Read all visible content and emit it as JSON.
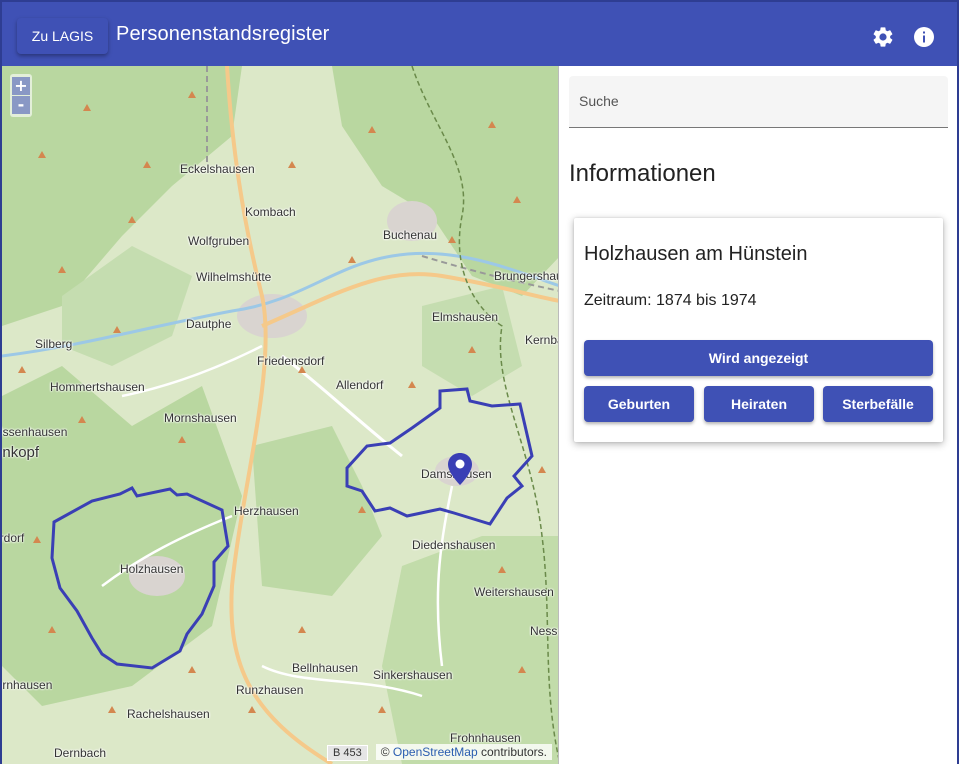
{
  "header": {
    "lagis_button": "Zu LAGIS",
    "title": "Personenstandsregister",
    "settings_icon": "gear-icon",
    "info_icon": "info-icon"
  },
  "map": {
    "zoom_in": "+",
    "zoom_out": "-",
    "places": [
      "Eckelshausen",
      "Kombach",
      "Buchenau",
      "Wolfgruben",
      "Wilhelmshütte",
      "Brungershausen",
      "Dautphe",
      "Elmshausen",
      "Kernbach",
      "Silberg",
      "Friedensdorf",
      "Hommertshausen",
      "Allendorf",
      "Mornshausen",
      "Biedenkopf",
      "Damshausen",
      "Herzhausen",
      "Holzhausen",
      "Diedenshausen",
      "Weitershausen",
      "Nesselbrunn",
      "Bellnhausen",
      "Sinkershausen",
      "Hornhausen",
      "Runzhausen",
      "Rachelshausen",
      "Dernbach",
      "Frohnhausen",
      "Ussenhausen",
      "Oberdorf"
    ],
    "road_shield": "B 453",
    "attribution_prefix": "©",
    "attribution_link": "OpenStreetMap",
    "attribution_suffix": "contributors.",
    "marker_icon": "map-pin-icon",
    "accent_color": "#3f51b5"
  },
  "search": {
    "placeholder": "Suche"
  },
  "info": {
    "heading": "Informationen",
    "card": {
      "title": "Holzhausen am Hünstein",
      "period": "Zeitraum: 1874 bis 1974",
      "primary_button": "Wird angezeigt",
      "buttons": [
        "Geburten",
        "Heiraten",
        "Sterbefälle"
      ]
    }
  }
}
